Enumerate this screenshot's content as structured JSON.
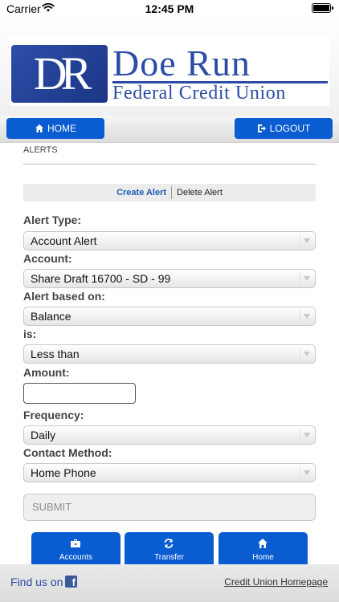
{
  "status": {
    "carrier": "Carrier",
    "time": "12:45 PM"
  },
  "logo": {
    "letters": "DR",
    "name": "Doe Run",
    "subtitle": "Federal Credit Union"
  },
  "nav": {
    "home_label": "HOME",
    "logout_label": "LOGOUT"
  },
  "section_title": "ALERTS",
  "subtabs": {
    "create": "Create Alert",
    "delete": "Delete Alert"
  },
  "form": {
    "alert_type": {
      "label": "Alert Type:",
      "value": "Account Alert"
    },
    "account": {
      "label": "Account:",
      "value": "Share Draft 16700 - SD - 99"
    },
    "based_on": {
      "label": "Alert based on:",
      "value": "Balance"
    },
    "is": {
      "label": "is:",
      "value": "Less than"
    },
    "amount": {
      "label": "Amount:",
      "value": ""
    },
    "frequency": {
      "label": "Frequency:",
      "value": "Daily"
    },
    "contact_method": {
      "label": "Contact Method:",
      "value": "Home Phone"
    },
    "submit_label": "SUBMIT"
  },
  "bottom_nav": {
    "accounts": "Accounts",
    "transfer": "Transfer",
    "home": "Home"
  },
  "footer": {
    "find_us": "Find us on",
    "facebook_glyph": "f",
    "homepage_link": "Credit Union Homepage"
  },
  "colors": {
    "primary": "#0a5cd1",
    "brand": "#2b4ba5",
    "link": "#1d5bb5"
  }
}
